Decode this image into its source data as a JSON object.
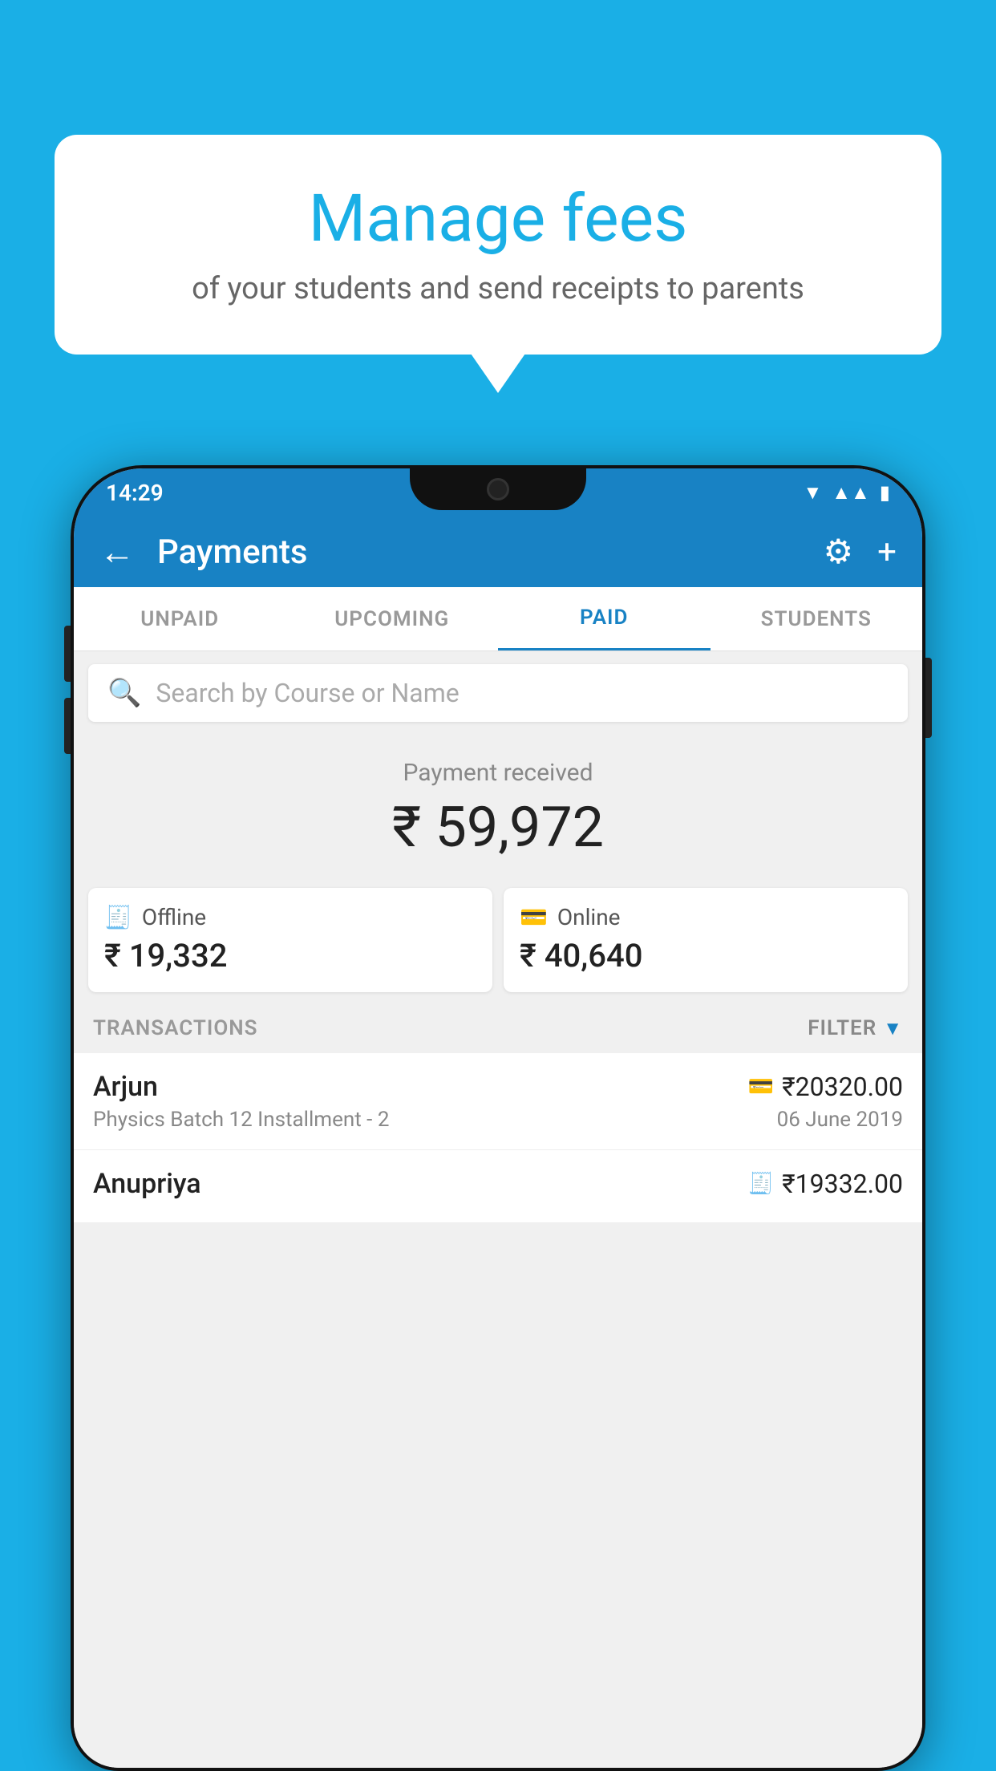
{
  "bubble": {
    "title": "Manage fees",
    "subtitle": "of your students and send receipts to parents"
  },
  "status_bar": {
    "time": "14:29"
  },
  "app_bar": {
    "title": "Payments",
    "back_label": "←",
    "gear_label": "⚙",
    "plus_label": "+"
  },
  "tabs": [
    {
      "label": "UNPAID",
      "active": false
    },
    {
      "label": "UPCOMING",
      "active": false
    },
    {
      "label": "PAID",
      "active": true
    },
    {
      "label": "STUDENTS",
      "active": false
    }
  ],
  "search": {
    "placeholder": "Search by Course or Name"
  },
  "payment_received": {
    "label": "Payment received",
    "amount": "₹ 59,972"
  },
  "cards": [
    {
      "type": "Offline",
      "amount": "₹ 19,332",
      "icon": "🧾"
    },
    {
      "type": "Online",
      "amount": "₹ 40,640",
      "icon": "💳"
    }
  ],
  "transactions": {
    "label": "TRANSACTIONS",
    "filter_label": "FILTER"
  },
  "transaction_list": [
    {
      "name": "Arjun",
      "description": "Physics Batch 12 Installment - 2",
      "amount": "₹20320.00",
      "date": "06 June 2019",
      "payment_type": "online"
    },
    {
      "name": "Anupriya",
      "description": "",
      "amount": "₹19332.00",
      "date": "",
      "payment_type": "offline"
    }
  ]
}
